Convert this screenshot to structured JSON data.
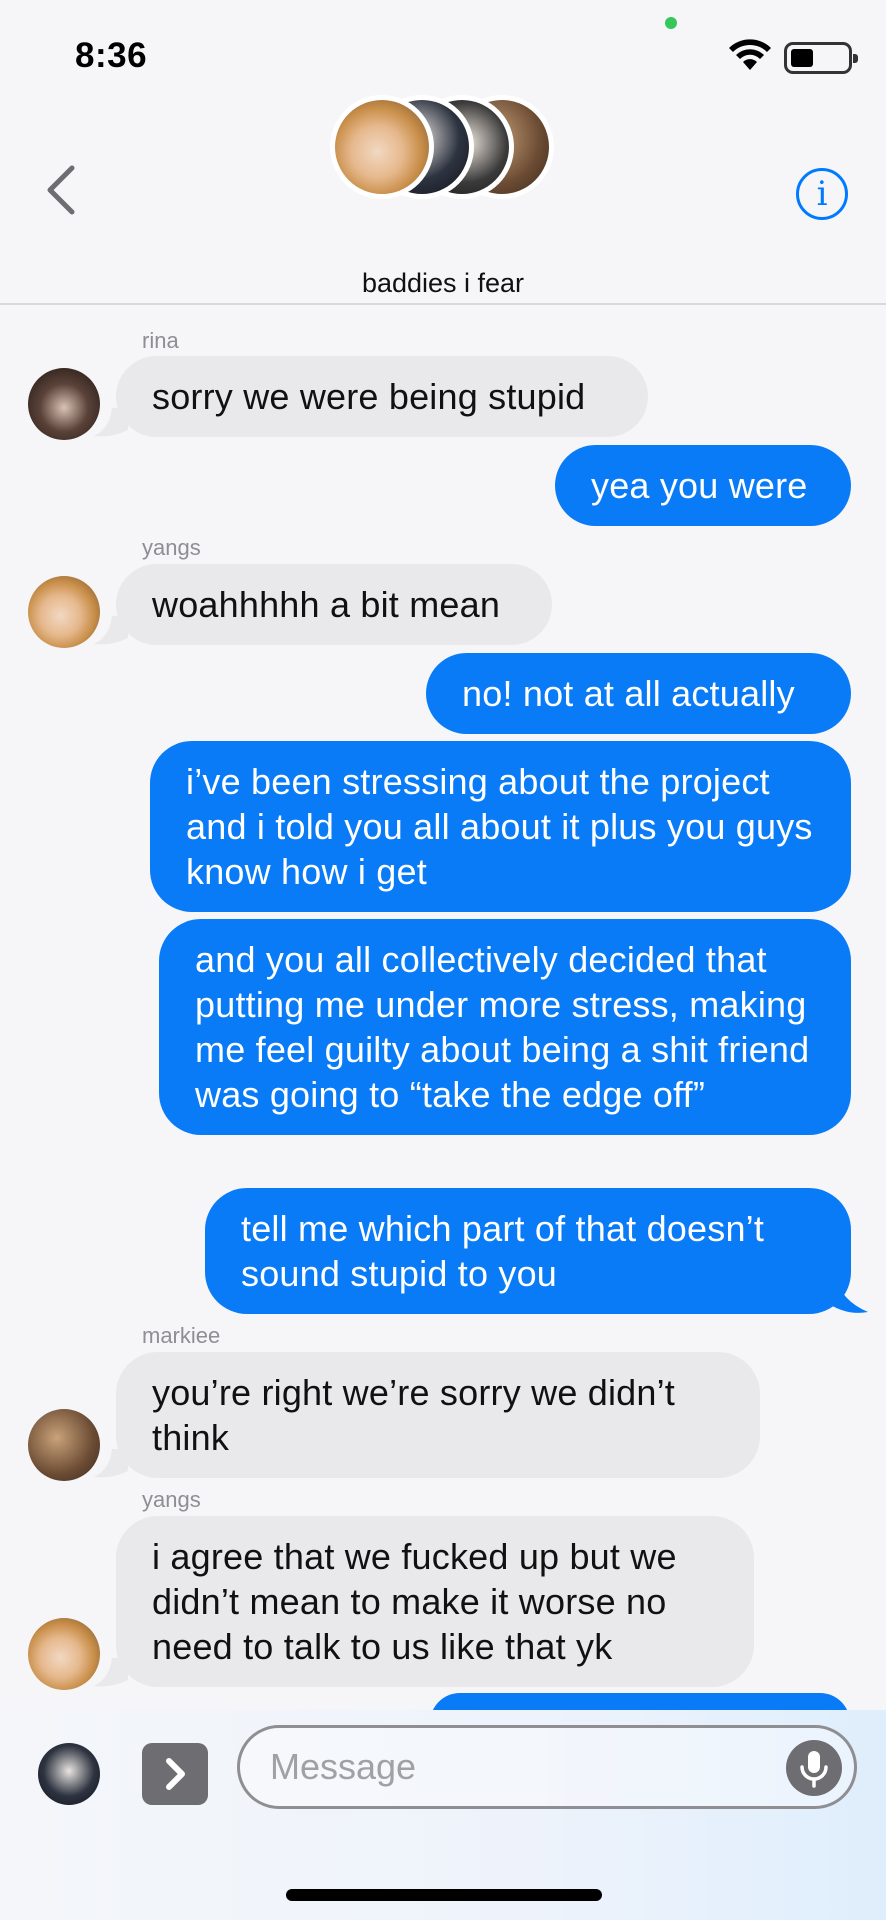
{
  "status_bar": {
    "time": "8:36"
  },
  "header": {
    "group_name": "baddies i fear"
  },
  "messages": [
    {
      "sender": "rina",
      "text": "sorry we were being stupid"
    },
    {
      "text": "yea you were"
    },
    {
      "sender": "yangs",
      "text": "woahhhhh a bit mean"
    },
    {
      "text": "no! not at all actually"
    },
    {
      "text": "i’ve been stressing about the project and i told you all about it plus you guys know how i get"
    },
    {
      "text": "and you all collectively decided that putting me under more stress, making me feel guilty about being a shit friend was going to “take the edge off”"
    },
    {
      "text": "tell me which part of that doesn’t sound stupid to you"
    },
    {
      "sender": "markiee",
      "text": "you’re right we’re sorry we didn’t think"
    },
    {
      "sender": "yangs",
      "text": "i agree that we fucked up but we didn’t mean to make it worse no need to talk to us like that yk"
    }
  ],
  "input": {
    "placeholder": "Message"
  },
  "colors": {
    "accent": "#007aff",
    "outgoing": "#0a7bf7",
    "incoming": "#e9e9eb",
    "online": "#34c759"
  },
  "icons": [
    "back-chevron-icon",
    "info-icon",
    "wifi-icon",
    "battery-icon",
    "apps-chevron-icon",
    "mic-icon"
  ]
}
